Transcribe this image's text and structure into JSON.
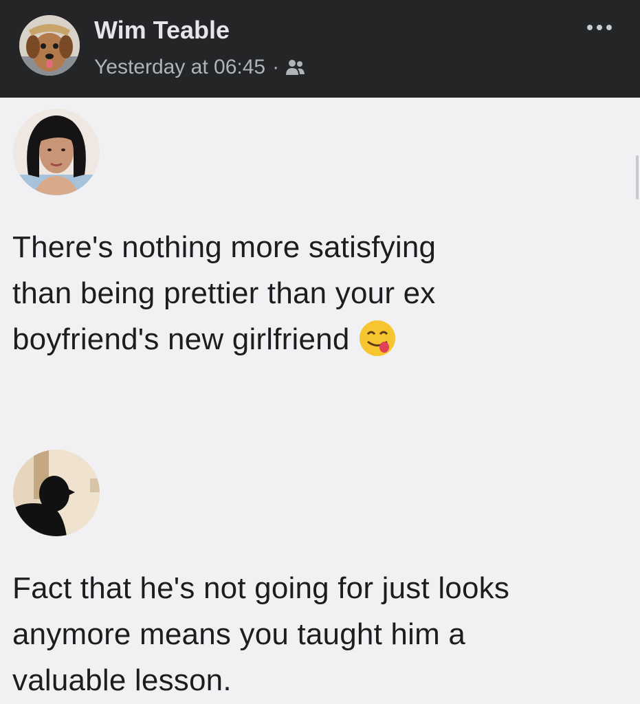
{
  "post": {
    "author_name": "Wim Teable",
    "timestamp": "Yesterday at 06:45",
    "separator": "·",
    "audience_icon": "friends-icon",
    "more_icon": "more-options-icon"
  },
  "comments": [
    {
      "avatar": "woman-portrait-avatar",
      "text_lines": [
        "There's nothing more satisfying",
        "than being prettier than your ex",
        "boyfriend's new girlfriend"
      ],
      "emoji": "face-savoring-food-emoji"
    },
    {
      "avatar": "silhouette-avatar",
      "text_lines": [
        "Fact that he's not going for just looks",
        "anymore means you taught him a",
        "valuable lesson."
      ]
    }
  ],
  "colors": {
    "header_background": "#242526",
    "name_text": "#e4e6eb",
    "meta_text": "#b0b3b8",
    "content_background": "#f1f1f4",
    "comment_text": "#1d1d1f"
  }
}
